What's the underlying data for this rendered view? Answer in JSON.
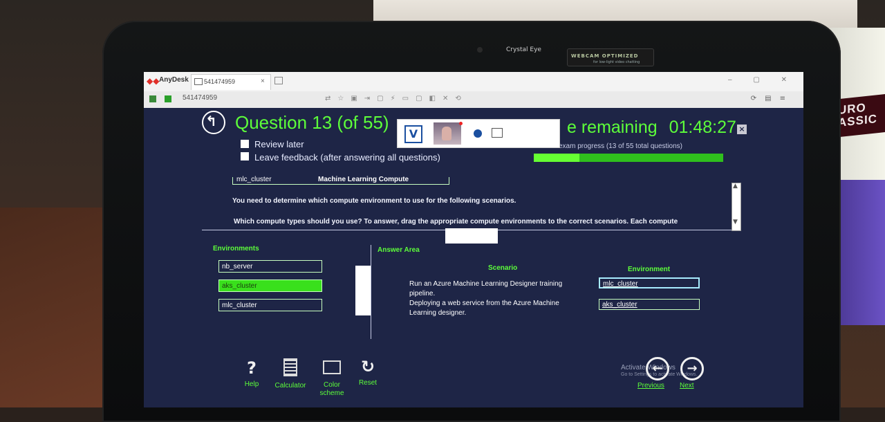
{
  "environment": {
    "laptop_brand": "Crystal Eye",
    "webcam_badge_line1": "WEBCAM OPTIMIZED",
    "webcam_badge_line2": "for low-light video chatting",
    "mug_text": "URO\nASSIC"
  },
  "anydesk": {
    "app_name": "AnyDesk",
    "tab_label": "541474959",
    "tab_close": "×",
    "address": "541474959",
    "window_buttons": "– ▢ ✕"
  },
  "exam": {
    "question_title": "Question 13 (of 55)",
    "review_later": "Review later",
    "leave_feedback": "Leave feedback (after answering all questions)",
    "time_remaining_label": "e remaining",
    "time_remaining_value": "01:48:27",
    "close_symbol": "×",
    "progress_label": "exam progress (13 of 55 total questions)",
    "progress_fraction": 0.24,
    "table": {
      "c1": "mlc_cluster",
      "c2": "Machine Learning Compute"
    },
    "question_text_1": "You need to determine which compute environment to use for the following scenarios.",
    "question_text_2": "Which compute types should you use? To answer, drag the appropriate compute environments to the correct scenarios. Each compute",
    "environments_header": "Environments",
    "environments": [
      {
        "label": "nb_server",
        "selected": false
      },
      {
        "label": "aks_cluster",
        "selected": true
      },
      {
        "label": "mlc_cluster",
        "selected": false
      }
    ],
    "answer_area_header": "Answer Area",
    "scenario_header": "Scenario",
    "environment_header": "Environment",
    "answers": [
      {
        "scenario": "Run an Azure Machine Learning Designer training pipeline.",
        "environment": "mlc_cluster"
      },
      {
        "scenario": "Deploying a web service from the Azure Machine Learning designer.",
        "environment": "aks_cluster"
      }
    ],
    "tools": {
      "help": "Help",
      "calculator": "Calculator",
      "color_scheme": "Color scheme",
      "reset": "Reset"
    },
    "nav": {
      "previous": "Previous",
      "next": "Next"
    },
    "activate_line1": "Activate Windows",
    "activate_line2": "Go to Settings to activate Windows."
  },
  "colors": {
    "exam_bg": "#1e2546",
    "accent_green": "#5dff3a",
    "selected_green": "#39e01c"
  }
}
